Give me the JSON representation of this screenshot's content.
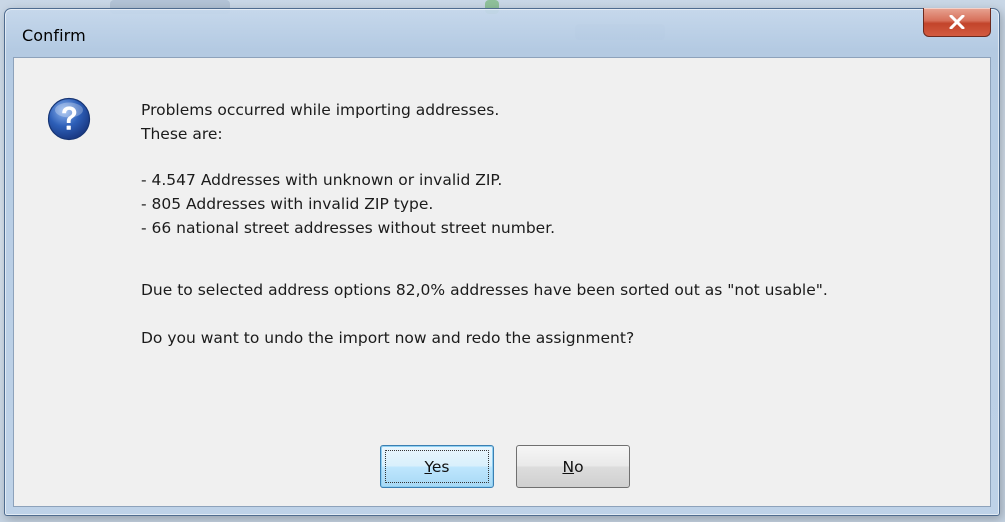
{
  "window": {
    "title": "Confirm"
  },
  "icons": {
    "message_icon": "question-icon",
    "close_icon": "close-icon"
  },
  "colors": {
    "title_bar": "#bcd0e6",
    "close_button": "#c9503a",
    "client_background": "#f0f0f0",
    "icon_blue": "#2d5fb8",
    "default_button_border": "#3c7fb1"
  },
  "message": {
    "intro_line1": "Problems occurred while importing addresses.",
    "intro_line2": "These are:",
    "problems": [
      "- 4.547 Addresses with unknown or invalid ZIP.",
      "- 805 Addresses with invalid ZIP type.",
      "- 66 national street addresses without street number."
    ],
    "summary": "Due to selected address options 82,0% addresses have been sorted out as \"not usable\".",
    "question": "Do you want to undo the import now and redo the assignment?"
  },
  "buttons": {
    "yes": {
      "accel": "Y",
      "rest": "es",
      "is_default": true
    },
    "no": {
      "accel": "N",
      "rest": "o",
      "is_default": false
    }
  }
}
